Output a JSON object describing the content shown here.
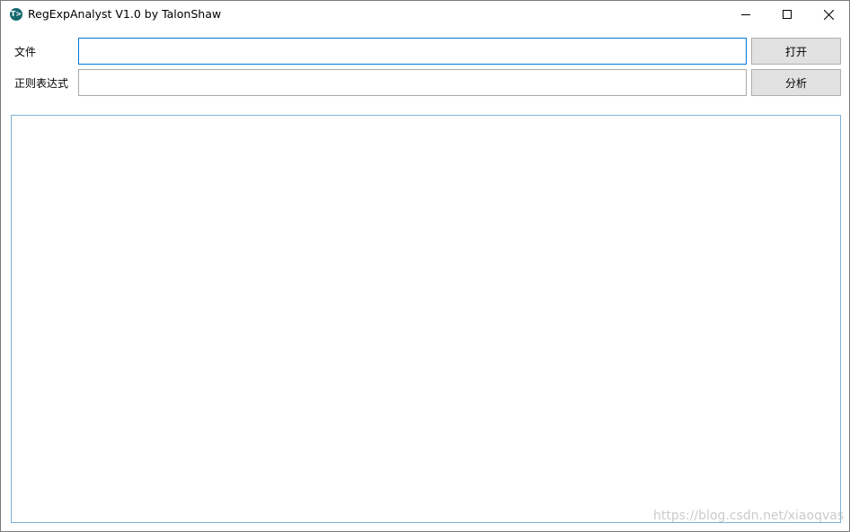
{
  "window": {
    "title": "RegExpAnalyst V1.0 by TalonShaw",
    "icon": "app-icon",
    "icon_glyph": "T>",
    "controls": {
      "minimize": "minimize-icon",
      "maximize": "maximize-icon",
      "close": "close-icon"
    }
  },
  "form": {
    "file_label": "文件",
    "file_value": "",
    "regex_label": "正则表达式",
    "regex_value": "",
    "open_button": "打开",
    "analyze_button": "分析"
  },
  "result": {
    "text": ""
  },
  "watermark": "https://blog.csdn.net/xiaoqvas",
  "colors": {
    "accent": "#0078d7",
    "button_bg": "#e1e1e1",
    "result_border": "#7fb4d6",
    "icon_bg": "#14676f"
  }
}
